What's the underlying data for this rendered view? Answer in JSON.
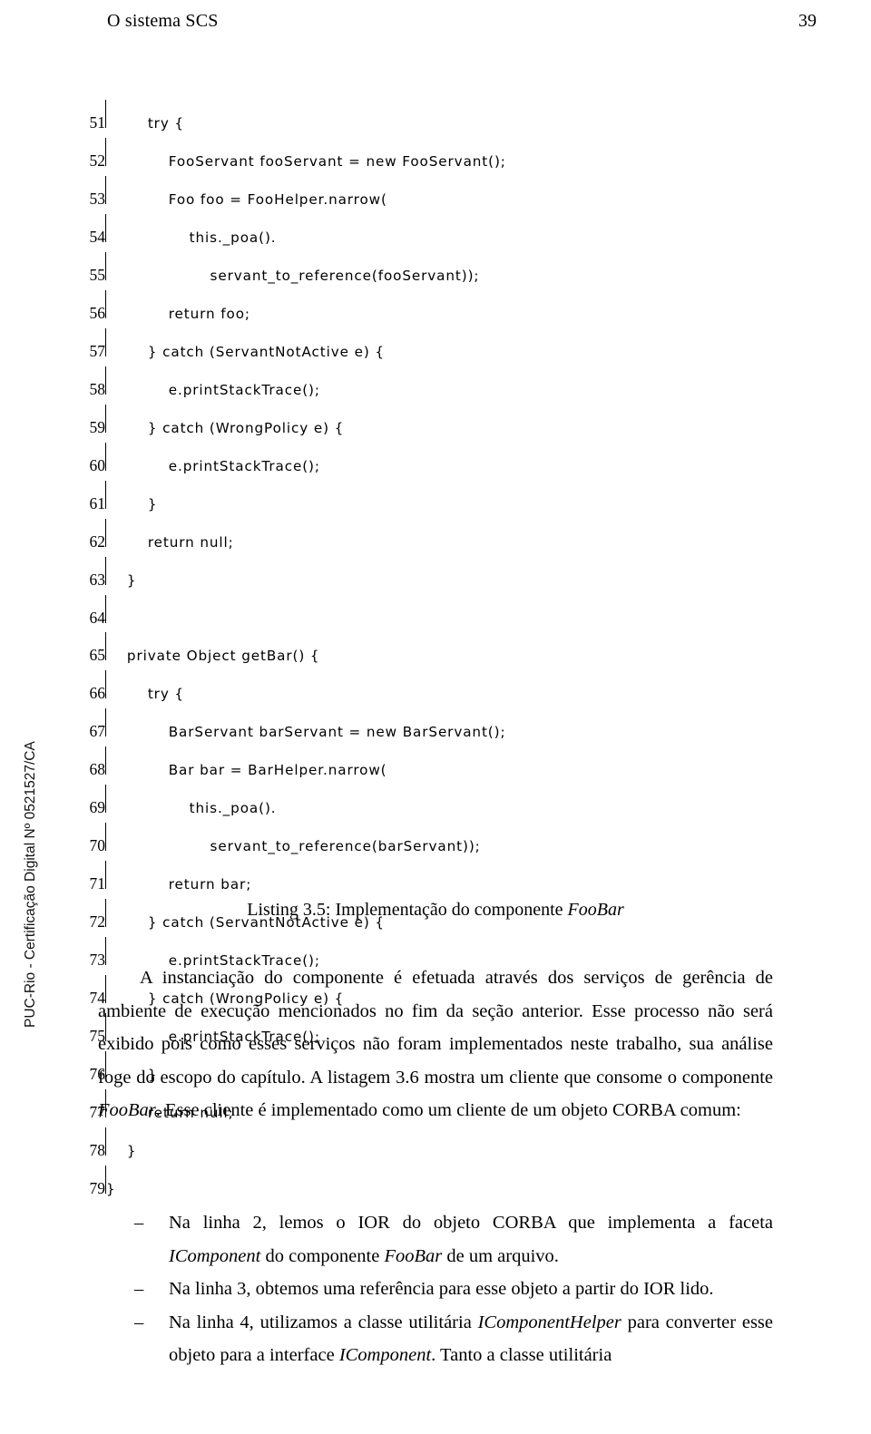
{
  "header": {
    "title": "O sistema SCS",
    "page_number": "39"
  },
  "side_stamp": "PUC-Rio - Certificação Digital Nº 0521527/CA",
  "listing": {
    "lines": [
      {
        "number": "51",
        "code": "        try {"
      },
      {
        "number": "52",
        "code": "            FooServant fooServant = new FooServant();"
      },
      {
        "number": "53",
        "code": "            Foo foo = FooHelper.narrow("
      },
      {
        "number": "54",
        "code": "                this._poa()."
      },
      {
        "number": "55",
        "code": "                    servant_to_reference(fooServant));"
      },
      {
        "number": "56",
        "code": "            return foo;"
      },
      {
        "number": "57",
        "code": "        } catch (ServantNotActive e) {"
      },
      {
        "number": "58",
        "code": "            e.printStackTrace();"
      },
      {
        "number": "59",
        "code": "        } catch (WrongPolicy e) {"
      },
      {
        "number": "60",
        "code": "            e.printStackTrace();"
      },
      {
        "number": "61",
        "code": "        }"
      },
      {
        "number": "62",
        "code": "        return null;"
      },
      {
        "number": "63",
        "code": "    }"
      },
      {
        "number": "64",
        "code": ""
      },
      {
        "number": "65",
        "code": "    private Object getBar() {"
      },
      {
        "number": "66",
        "code": "        try {"
      },
      {
        "number": "67",
        "code": "            BarServant barServant = new BarServant();"
      },
      {
        "number": "68",
        "code": "            Bar bar = BarHelper.narrow("
      },
      {
        "number": "69",
        "code": "                this._poa()."
      },
      {
        "number": "70",
        "code": "                    servant_to_reference(barServant));"
      },
      {
        "number": "71",
        "code": "            return bar;"
      },
      {
        "number": "72",
        "code": "        } catch (ServantNotActive e) {"
      },
      {
        "number": "73",
        "code": "            e.printStackTrace();"
      },
      {
        "number": "74",
        "code": "        } catch (WrongPolicy e) {"
      },
      {
        "number": "75",
        "code": "            e.printStackTrace();"
      },
      {
        "number": "76",
        "code": "        }"
      },
      {
        "number": "77",
        "code": "        return null;"
      },
      {
        "number": "78",
        "code": "    }"
      },
      {
        "number": "79",
        "code": "}"
      }
    ]
  },
  "caption": {
    "label": "Listing 3.5: Implementação do componente ",
    "emphasis": "FooBar"
  },
  "body": {
    "paragraph_1": "A instanciação do componente é efetuada através dos serviços de gerência de ambiente de execução mencionados no fim da seção anterior. Esse processo não será exibido pois como esses serviços não foram implementados neste trabalho, sua análise foge do escopo do capítulo. A listagem 3.6 mostra um cliente que consome o componente ",
    "paragraph_1_em": "FooBar",
    "paragraph_1_cont": ". Esse cliente é implementado como um cliente de um objeto CORBA comum:"
  },
  "items": [
    {
      "marker": "–",
      "text_1": "Na linha 2, lemos o IOR do objeto CORBA que implementa a faceta ",
      "em_1": "IComponent",
      "text_2": " do componente ",
      "em_2": "FooBar",
      "text_3": " de um arquivo."
    },
    {
      "marker": "–",
      "text_1": "Na linha 3, obtemos uma referência para esse objeto a partir do IOR lido.",
      "em_1": "",
      "text_2": "",
      "em_2": "",
      "text_3": ""
    },
    {
      "marker": "–",
      "text_1": "Na linha 4, utilizamos a classe utilitária ",
      "em_1": "IComponentHelper",
      "text_2": " para converter esse objeto para a interface ",
      "em_2": "IComponent",
      "text_3": ". Tanto a classe utilitária"
    }
  ]
}
